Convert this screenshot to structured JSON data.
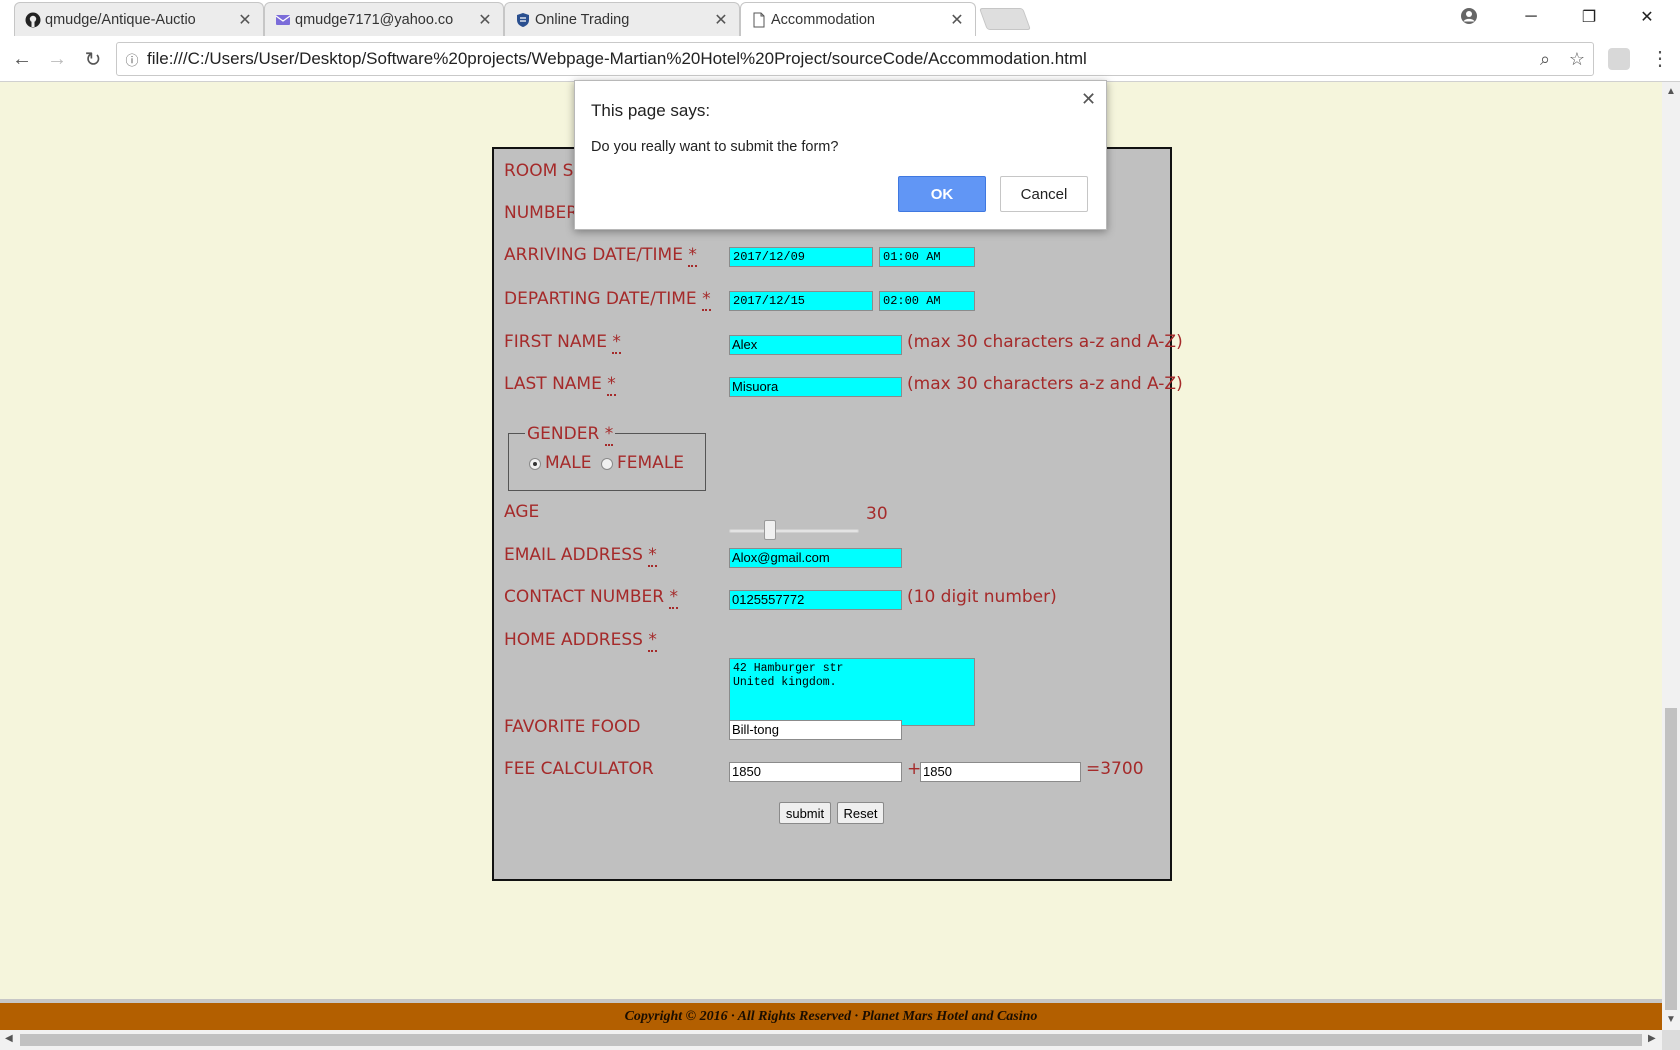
{
  "tabs": [
    {
      "title": "qmudge/Antique-Auctio",
      "icon": "github-icon",
      "close": "✕"
    },
    {
      "title": "qmudge7171@yahoo.co",
      "icon": "mail-icon",
      "close": "✕"
    },
    {
      "title": "Online Trading",
      "icon": "bank-shield-icon",
      "close": "✕"
    },
    {
      "title": "Accommodation",
      "icon": "page-icon",
      "close": "✕"
    }
  ],
  "window_controls": {
    "minimize": "─",
    "restore": "❐",
    "close": "✕"
  },
  "address_bar": {
    "url": "file:///C:/Users/User/Desktop/Software%20projects/Webpage-Martian%20Hotel%20Project/sourceCode/Accommodation.html"
  },
  "form": {
    "room_label": "ROOM S",
    "number_label": "NUMBER",
    "arriving": {
      "label": "ARRIVING DATE/TIME",
      "req": "*",
      "date": "2017/12/09",
      "time": "01:00 AM"
    },
    "departing": {
      "label": "DEPARTING DATE/TIME",
      "req": "*",
      "date": "2017/12/15",
      "time": "02:00 AM"
    },
    "first_name": {
      "label": "FIRST NAME",
      "req": "*",
      "value": "Alex",
      "note": "(max 30 characters a-z and A-Z)"
    },
    "last_name": {
      "label": "LAST NAME",
      "req": "*",
      "value": "Misuora",
      "note": "(max 30 characters a-z and A-Z)"
    },
    "gender": {
      "legend": "GENDER",
      "req": "*",
      "male": "MALE",
      "female": "FEMALE",
      "selected": "MALE"
    },
    "age": {
      "label": "AGE",
      "value": "30",
      "level": 0.3
    },
    "email": {
      "label": "EMAIL ADDRESS",
      "req": "*",
      "value": "Alox@gmail.com"
    },
    "contact": {
      "label": "CONTACT NUMBER",
      "req": "*",
      "value": "0125557772",
      "note": "(10 digit number)"
    },
    "address": {
      "label": "HOME ADDRESS",
      "req": "*",
      "value": "42 Hamburger str\nUnited kingdom."
    },
    "food": {
      "label": "FAVORITE FOOD",
      "value": "Bill-tong"
    },
    "fee": {
      "label": "FEE CALCULATOR",
      "a": "1850",
      "plus": "+",
      "b": "1850",
      "result": "=3700"
    },
    "buttons": {
      "submit": "submit",
      "reset": "Reset"
    }
  },
  "footer": {
    "text": "Copyright © 2016 · All Rights Reserved · Planet Mars Hotel and Casino"
  },
  "dialog": {
    "title": "This page says:",
    "message": "Do you really want to submit the form?",
    "ok": "OK",
    "cancel": "Cancel",
    "close": "✕"
  },
  "colors": {
    "page_bg": "#f5f5dc",
    "form_bg": "#c0c0c0",
    "label": "#a52a2a",
    "input_bg": "#00ffff",
    "footer_bg": "#b35f00",
    "ok_button": "#6196f5"
  }
}
